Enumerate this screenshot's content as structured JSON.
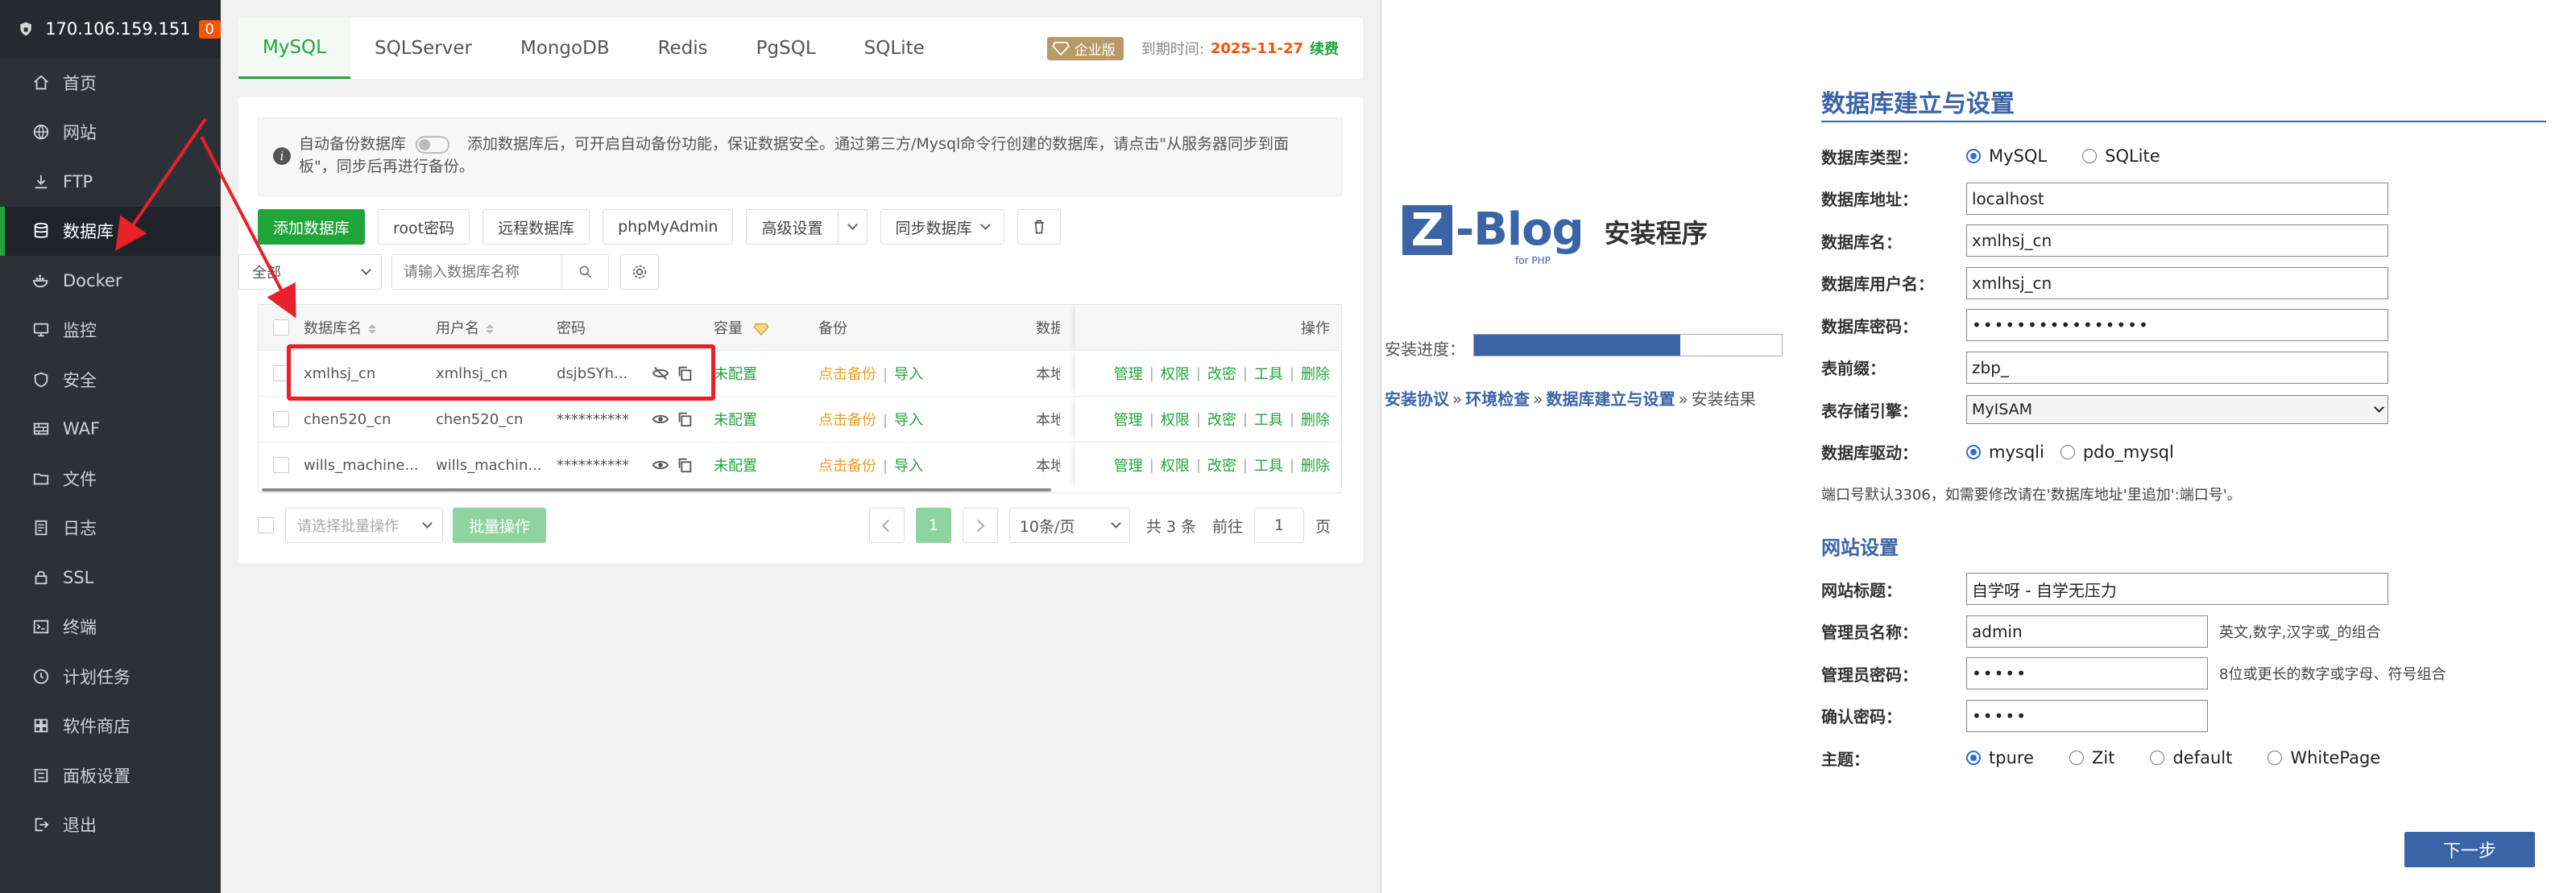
{
  "sidebar": {
    "server_ip": "170.106.159.151",
    "badge": "0",
    "items": [
      {
        "label": "首页",
        "icon": "home-icon"
      },
      {
        "label": "网站",
        "icon": "globe-icon"
      },
      {
        "label": "FTP",
        "icon": "ftp-icon"
      },
      {
        "label": "数据库",
        "icon": "database-icon"
      },
      {
        "label": "Docker",
        "icon": "docker-icon"
      },
      {
        "label": "监控",
        "icon": "monitor-icon"
      },
      {
        "label": "安全",
        "icon": "shield-icon"
      },
      {
        "label": "WAF",
        "icon": "waf-icon"
      },
      {
        "label": "文件",
        "icon": "folder-icon"
      },
      {
        "label": "日志",
        "icon": "log-icon"
      },
      {
        "label": "SSL",
        "icon": "ssl-icon"
      },
      {
        "label": "终端",
        "icon": "terminal-icon"
      },
      {
        "label": "计划任务",
        "icon": "clock-icon"
      },
      {
        "label": "软件商店",
        "icon": "store-icon"
      },
      {
        "label": "面板设置",
        "icon": "settings-icon"
      },
      {
        "label": "退出",
        "icon": "logout-icon"
      }
    ],
    "active_index": 3
  },
  "tabs": [
    "MySQL",
    "SQLServer",
    "MongoDB",
    "Redis",
    "PgSQL",
    "SQLite"
  ],
  "edition": {
    "badge": "企业版",
    "expire_label": "到期时间:",
    "expire_date": "2025-11-27",
    "renew": "续费"
  },
  "notice": {
    "toggle_label": "自动备份数据库",
    "text": "添加数据库后，可开启自动备份功能，保证数据安全。通过第三方/Mysql命令行创建的数据库，请点击\"从服务器同步到面板\"，同步后再进行备份。"
  },
  "toolbar": {
    "add": "添加数据库",
    "root_pwd": "root密码",
    "remote": "远程数据库",
    "pma": "phpMyAdmin",
    "advanced": "高级设置",
    "sync": "同步数据库"
  },
  "filter": {
    "category": "全部",
    "search_placeholder": "请输入数据库名称"
  },
  "table": {
    "headers": {
      "name": "数据库名",
      "user": "用户名",
      "password": "密码",
      "capacity": "容量",
      "backup": "备份",
      "location": "数据",
      "ops": "操作"
    },
    "rows": [
      {
        "name": "xmlhsj_cn",
        "user": "xmlhsj_cn",
        "password": "dsjbSYh...",
        "capacity": "未配置",
        "backup": "点击备份",
        "import": "导入",
        "location": "本地"
      },
      {
        "name": "chen520_cn",
        "user": "chen520_cn",
        "password": "**********",
        "capacity": "未配置",
        "backup": "点击备份",
        "import": "导入",
        "location": "本地"
      },
      {
        "name": "wills_machine...",
        "user": "wills_machin...",
        "password": "**********",
        "capacity": "未配置",
        "backup": "点击备份",
        "import": "导入",
        "location": "本地"
      }
    ],
    "ops": [
      "管理",
      "权限",
      "改密",
      "工具",
      "删除"
    ]
  },
  "pager": {
    "batch_placeholder": "请选择批量操作",
    "batch_btn": "批量操作",
    "current_page": "1",
    "per_page": "10条/页",
    "total": "共 3 条",
    "goto_label": "前往",
    "goto_value": "1",
    "page_unit": "页"
  },
  "installer": {
    "logo_z": "Z",
    "logo_word": "-Blog",
    "logo_sub": "for PHP",
    "title": "安装程序",
    "progress_label": "安装进度：",
    "progress": 0.67,
    "steps": [
      "安装协议",
      "环境检查",
      "数据库建立与设置",
      "安装结果"
    ],
    "form_title": "数据库建立与设置",
    "db_type_label": "数据库类型：",
    "db_type_options": [
      "MySQL",
      "SQLite"
    ],
    "db_host_label": "数据库地址：",
    "db_host": "localhost",
    "db_name_label": "数据库名：",
    "db_name": "xmlhsj_cn",
    "db_user_label": "数据库用户名：",
    "db_user": "xmlhsj_cn",
    "db_pwd_label": "数据库密码：",
    "db_pwd": "••••••••••••••••",
    "prefix_label": "表前缀：",
    "prefix": "zbp_",
    "engine_label": "表存储引擎：",
    "engine": "MyISAM",
    "driver_label": "数据库驱动：",
    "driver_options": [
      "mysqli",
      "pdo_mysql"
    ],
    "port_note": "端口号默认3306，如需要修改请在'数据库地址'里追加':端口号'。",
    "site_section": "网站设置",
    "site_title_label": "网站标题：",
    "site_title": "自学呀 - 自学无压力",
    "admin_label": "管理员名称：",
    "admin": "admin",
    "admin_hint": "英文,数字,汉字或_的组合",
    "admin_pwd_label": "管理员密码：",
    "admin_pwd": "•••••",
    "admin_pwd_hint": "8位或更长的数字或字母、符号组合",
    "confirm_label": "确认密码：",
    "confirm_pwd": "•••••",
    "theme_label": "主题：",
    "themes": [
      "tpure",
      "Zit",
      "default",
      "WhitePage"
    ],
    "next": "下一步"
  },
  "colors": {
    "sidebar_bg": "#2c3138",
    "green": "#20a53a",
    "orange": "#f0560a",
    "zblog_blue": "#3a64a6",
    "annotation_red": "#e8202a"
  }
}
